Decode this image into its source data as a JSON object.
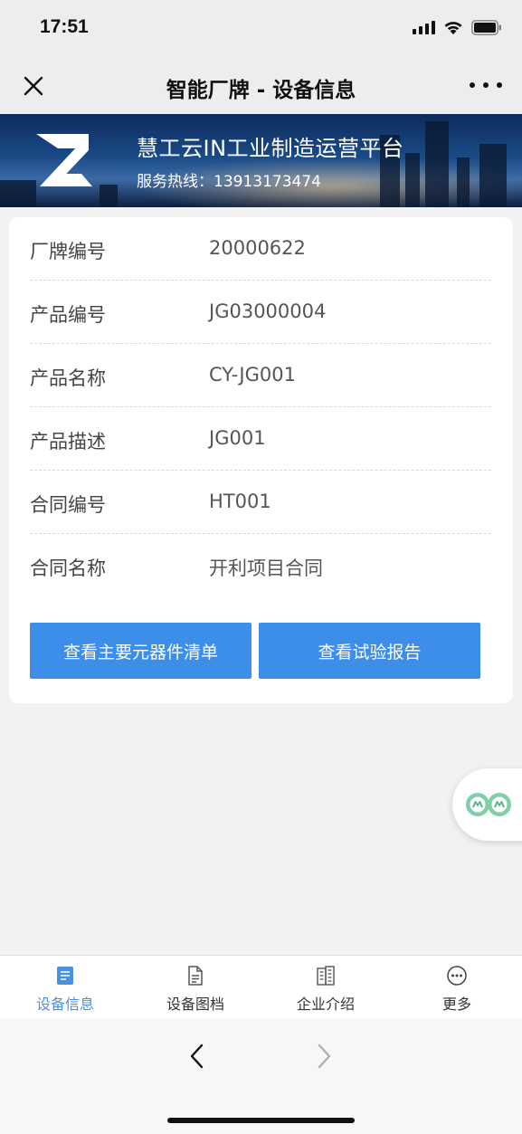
{
  "status_bar": {
    "time": "17:51"
  },
  "nav": {
    "title": "智能厂牌 - 设备信息"
  },
  "banner": {
    "title": "慧工云IN工业制造运营平台",
    "hotline": "服务热线：13913173474"
  },
  "info": {
    "rows": [
      {
        "label": "厂牌编号",
        "value": "20000622"
      },
      {
        "label": "产品编号",
        "value": "JG03000004"
      },
      {
        "label": "产品名称",
        "value": "CY-JG001"
      },
      {
        "label": "产品描述",
        "value": "JG001"
      },
      {
        "label": "合同编号",
        "value": "HT001"
      },
      {
        "label": "合同名称",
        "value": "开利项目合同"
      }
    ],
    "buttons": {
      "components": "查看主要元器件清单",
      "reports": "查看试验报告"
    }
  },
  "tabs": [
    {
      "label": "设备信息",
      "icon": "document-icon",
      "active": true
    },
    {
      "label": "设备图档",
      "icon": "file-icon",
      "active": false
    },
    {
      "label": "企业介绍",
      "icon": "building-icon",
      "active": false
    },
    {
      "label": "更多",
      "icon": "more-icon",
      "active": false
    }
  ],
  "colors": {
    "accent": "#3d8ee8",
    "tab_active": "#4a90e2",
    "background": "#f2f2f2"
  }
}
